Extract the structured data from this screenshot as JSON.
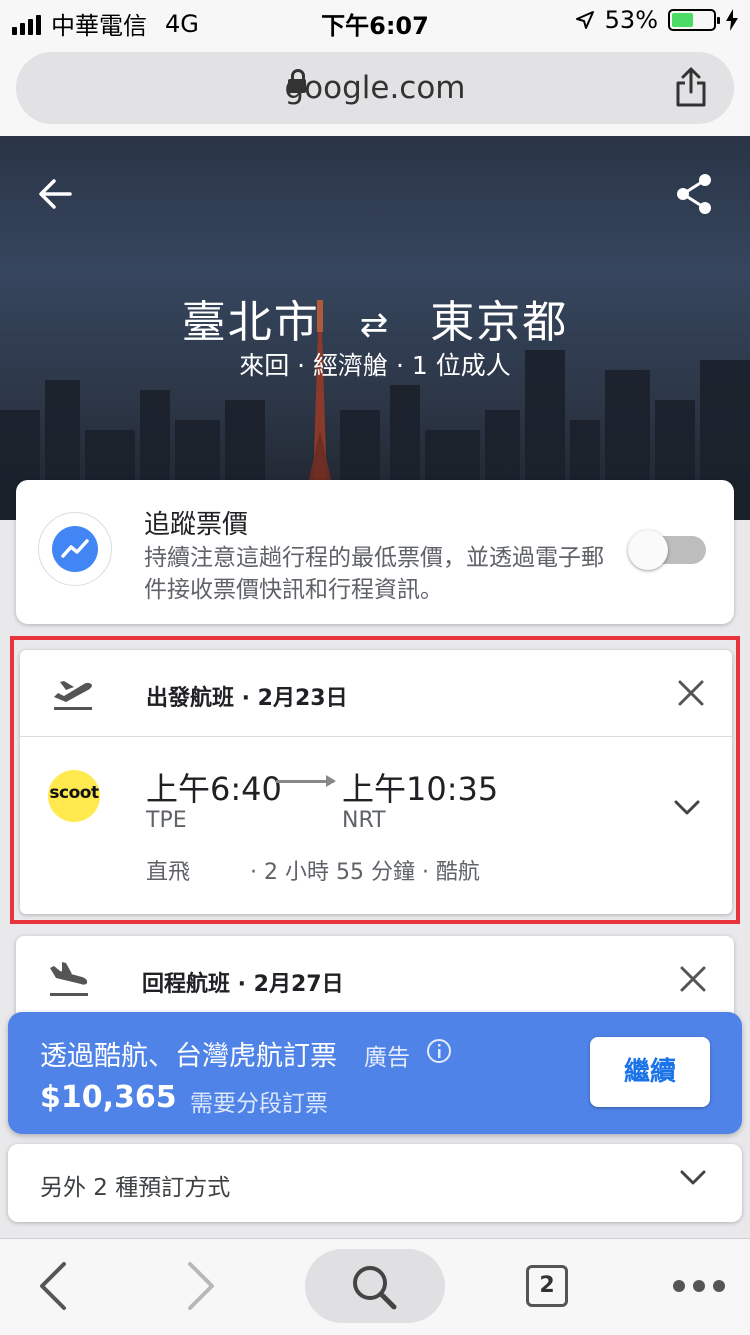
{
  "status_bar": {
    "carrier": "中華電信",
    "network": "4G",
    "time": "下午6:07",
    "battery": "53%",
    "battery_level": 0.53
  },
  "browser": {
    "url": "google.com"
  },
  "hero": {
    "origin": "臺北市",
    "destination": "東京都",
    "subtitle": "來回 · 經濟艙 · 1 位成人"
  },
  "track_prices": {
    "title": "追蹤票價",
    "description": "持續注意這趟行程的最低票價，並透過電子郵件接收票價快訊和行程資訊。",
    "enabled": false
  },
  "departing": {
    "header": "出發航班 · 2月23日",
    "airline_logo": "scoot",
    "depart_time": "上午6:40",
    "arrive_time": "上午10:35",
    "depart_code": "TPE",
    "arrive_code": "NRT",
    "stops": "直飛",
    "details": "· 2 小時 55 分鐘 · 酷航"
  },
  "returning": {
    "header": "回程航班 · 2月27日"
  },
  "booking": {
    "title": "透過酷航、台灣虎航訂票",
    "ad_label": "廣告",
    "price": "$10,365",
    "note": "需要分段訂票",
    "continue_label": "繼續"
  },
  "other_options": {
    "label": "另外 2 種預訂方式"
  },
  "toolbar": {
    "tab_count": "2"
  },
  "colors": {
    "accent": "#4285f4",
    "booking_bg": "#4f83e8",
    "highlight": "#e8323c",
    "scoot_yellow": "#ffe94f"
  }
}
